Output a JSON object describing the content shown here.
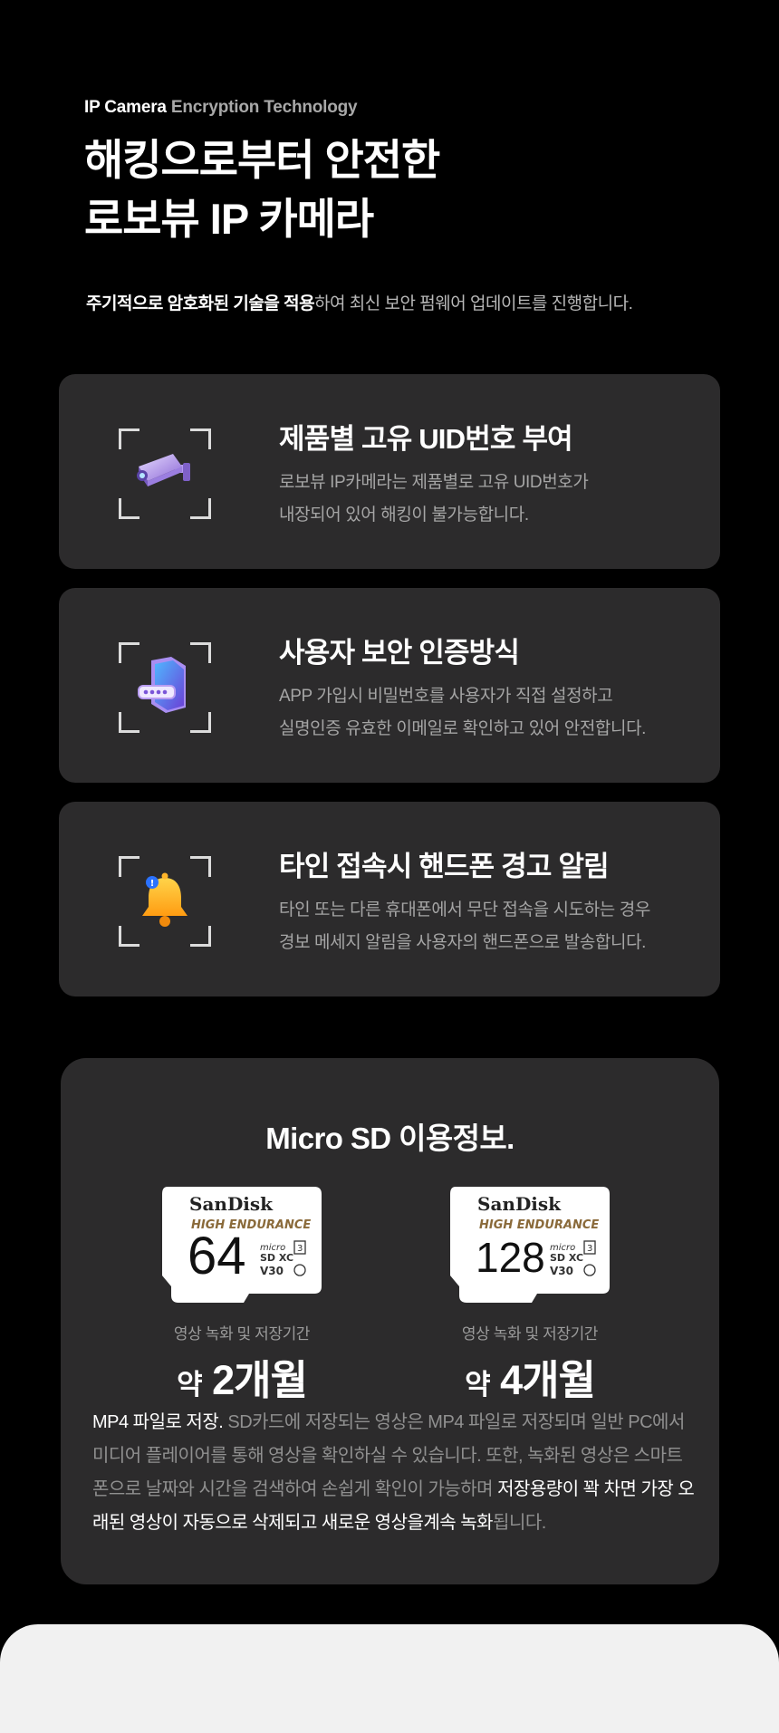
{
  "hero": {
    "eyebrow_strong": "IP Camera",
    "eyebrow_rest": "Encryption Technology",
    "headline_line1": "해킹으로부터 안전한",
    "headline_line2": "로보뷰 IP 카메라",
    "desc_highlight": "주기적으로 암호화된 기술을 적용",
    "desc_rest": "하여 최신 보안 펌웨어 업데이트를 진행합니다."
  },
  "features": [
    {
      "icon": "cctv-camera-icon",
      "title": "제품별 고유 UID번호 부여",
      "desc_line1": "로보뷰 IP카메라는 제품별로 고유 UID번호가",
      "desc_line2": "내장되어 있어 해킹이 불가능합니다."
    },
    {
      "icon": "password-folder-icon",
      "title": "사용자 보안 인증방식",
      "desc_line1": "APP 가입시 비밀번호를 사용자가 직접 설정하고",
      "desc_line2": "실명인증 유효한 이메일로 확인하고 있어 안전합니다."
    },
    {
      "icon": "notification-bell-icon",
      "title": "타인 접속시 핸드폰 경고 알림",
      "desc_line1": "타인 또는 다른 휴대폰에서 무단 접속을 시도하는 경우",
      "desc_line2": "경보 메세지 알림을 사용자의 핸드폰으로 발송합니다."
    }
  ],
  "sd": {
    "title": "Micro SD 이용정보.",
    "cards": [
      {
        "brand": "SanDisk",
        "line": "HIGH ENDURANCE",
        "capacity": "64",
        "label": "영상 녹화 및 저장기간",
        "prefix": "약",
        "duration": "2개월"
      },
      {
        "brand": "SanDisk",
        "line": "HIGH ENDURANCE",
        "capacity": "128",
        "label": "영상 녹화 및 저장기간",
        "prefix": "약",
        "duration": "4개월"
      }
    ],
    "body_strong": "MP4 파일로 저장.",
    "body_text": " SD카드에 저장되는 영상은 MP4 파일로 저장되며 일반 PC에서 미디어 플레이어를 통해 영상을 확인하실 수 있습니다. 또한, 녹화된 영상은 스마트폰으로 날짜와 시간을 검색하여 손쉽게 확인이 가능하며 ",
    "body_highlight": "저장용량이 꽉 차면 가장 오래된 영상이 자동으로 삭제되고 새로운 영상을계속 녹화",
    "body_end": "됩니다."
  },
  "colors": {
    "background": "#000000",
    "card": "#2c2b2c",
    "bottom_sheet": "#f1f1f1",
    "muted_text": "#a5a5a5"
  }
}
